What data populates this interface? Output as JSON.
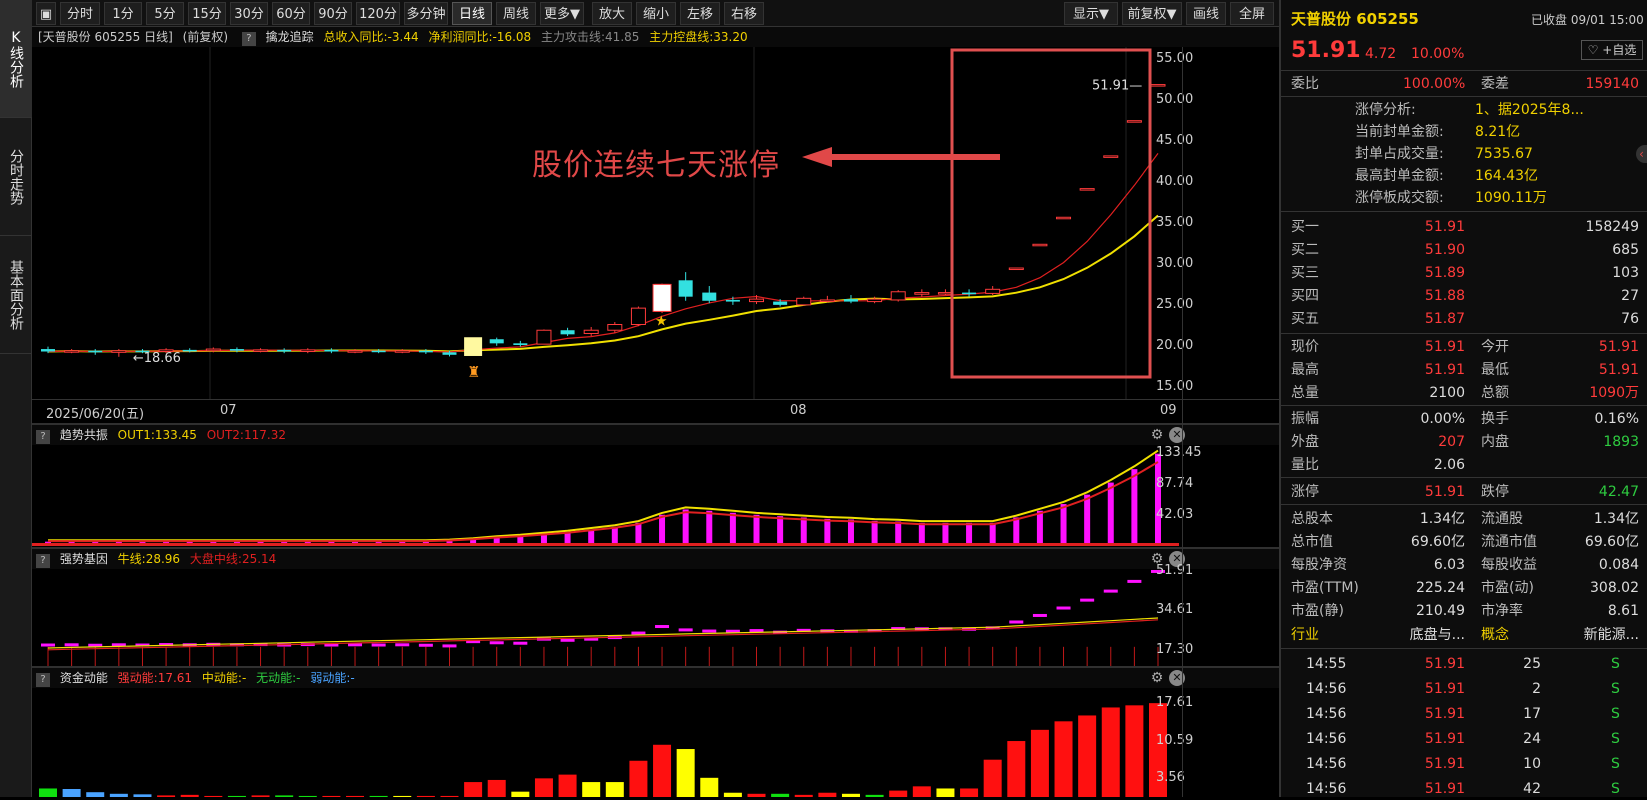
{
  "nav": {
    "tabs": [
      {
        "label": "K线分析",
        "active": true
      },
      {
        "label": "分时走势",
        "active": false
      },
      {
        "label": "基本面分析",
        "active": false
      }
    ]
  },
  "toolbar": {
    "buttons": [
      "分时",
      "1分",
      "5分",
      "15分",
      "30分",
      "60分",
      "90分",
      "120分",
      "多分钟",
      "日线",
      "周线",
      "更多▼",
      "放大",
      "缩小",
      "左移",
      "右移",
      "显示▼",
      "前复权▼",
      "画线",
      "全屏"
    ],
    "active": "日线"
  },
  "main_chart": {
    "info": {
      "title": "[天普股份 605255 日线]",
      "adjust": "(前复权)",
      "indicator": "擒龙追踪",
      "rev_yoy": "总收入同比:-3.44",
      "profit_yoy": "净利润同比:-16.08",
      "attack_line": "主力攻击线:41.85",
      "control_line": "主力控盘线:33.20"
    },
    "annotation": "股价连续七天涨停",
    "low_marker": "18.66",
    "high_marker": "51.91",
    "date_labels": [
      "2025/06/20(五)",
      "07",
      "08",
      "09"
    ],
    "colors": {
      "up": "#ff3b3b",
      "down": "#33e0e0",
      "ma1": "#f0e000",
      "ma2": "#e02020",
      "highlight": "#e05050"
    }
  },
  "chart_data": [
    {
      "type": "candlestick",
      "title": "天普股份 605255 日线",
      "yticks": [
        "55.00",
        "50.00",
        "45.00",
        "40.00",
        "35.00",
        "30.00",
        "25.00",
        "20.00",
        "15.00"
      ],
      "ylim": [
        13.5,
        56.5
      ],
      "x_labels": [
        "2025/06/20(五)",
        "07",
        "08",
        "09"
      ],
      "candles": [
        {
          "o": 19.6,
          "c": 19.3,
          "h": 19.9,
          "l": 19.1
        },
        {
          "o": 19.3,
          "c": 19.4,
          "h": 19.6,
          "l": 19.1
        },
        {
          "o": 19.4,
          "c": 19.2,
          "h": 19.6,
          "l": 18.9
        },
        {
          "o": 19.2,
          "c": 19.4,
          "h": 19.6,
          "l": 18.66
        },
        {
          "o": 19.4,
          "c": 19.3,
          "h": 19.6,
          "l": 19.1
        },
        {
          "o": 19.3,
          "c": 19.5,
          "h": 19.7,
          "l": 19.1
        },
        {
          "o": 19.5,
          "c": 19.4,
          "h": 19.7,
          "l": 19.2
        },
        {
          "o": 19.4,
          "c": 19.6,
          "h": 19.8,
          "l": 19.2
        },
        {
          "o": 19.6,
          "c": 19.4,
          "h": 19.8,
          "l": 19.2
        },
        {
          "o": 19.4,
          "c": 19.5,
          "h": 19.7,
          "l": 19.2
        },
        {
          "o": 19.5,
          "c": 19.3,
          "h": 19.7,
          "l": 19.1
        },
        {
          "o": 19.3,
          "c": 19.5,
          "h": 19.7,
          "l": 19.1
        },
        {
          "o": 19.5,
          "c": 19.3,
          "h": 19.7,
          "l": 19.1
        },
        {
          "o": 19.3,
          "c": 19.4,
          "h": 19.6,
          "l": 19.1
        },
        {
          "o": 19.4,
          "c": 19.3,
          "h": 19.6,
          "l": 19.1
        },
        {
          "o": 19.3,
          "c": 19.4,
          "h": 19.6,
          "l": 19.1
        },
        {
          "o": 19.4,
          "c": 19.2,
          "h": 19.6,
          "l": 19.0
        },
        {
          "o": 19.2,
          "c": 18.9,
          "h": 19.4,
          "l": 18.7
        },
        {
          "o": 19.0,
          "c": 20.8,
          "h": 20.8,
          "l": 19.0
        },
        {
          "o": 20.8,
          "c": 20.3,
          "h": 21.0,
          "l": 20.0
        },
        {
          "o": 20.3,
          "c": 20.1,
          "h": 20.6,
          "l": 19.9
        },
        {
          "o": 20.2,
          "c": 21.9,
          "h": 22.0,
          "l": 20.2
        },
        {
          "o": 21.9,
          "c": 21.4,
          "h": 22.2,
          "l": 21.2
        },
        {
          "o": 21.5,
          "c": 21.9,
          "h": 22.3,
          "l": 21.2
        },
        {
          "o": 21.9,
          "c": 22.6,
          "h": 22.9,
          "l": 21.6
        },
        {
          "o": 22.6,
          "c": 24.6,
          "h": 24.8,
          "l": 22.4
        },
        {
          "o": 24.2,
          "c": 27.5,
          "h": 27.6,
          "l": 24.0
        },
        {
          "o": 28.0,
          "c": 26.0,
          "h": 29.0,
          "l": 25.5
        },
        {
          "o": 26.5,
          "c": 25.5,
          "h": 27.3,
          "l": 25.2
        },
        {
          "o": 25.6,
          "c": 25.4,
          "h": 26.0,
          "l": 25.0
        },
        {
          "o": 25.4,
          "c": 25.7,
          "h": 26.2,
          "l": 25.1
        },
        {
          "o": 25.4,
          "c": 25.0,
          "h": 25.7,
          "l": 24.8
        },
        {
          "o": 25.0,
          "c": 25.8,
          "h": 26.0,
          "l": 24.9
        },
        {
          "o": 25.6,
          "c": 25.6,
          "h": 26.1,
          "l": 25.3
        },
        {
          "o": 25.7,
          "c": 25.4,
          "h": 26.2,
          "l": 25.2
        },
        {
          "o": 25.4,
          "c": 25.7,
          "h": 26.0,
          "l": 25.2
        },
        {
          "o": 25.6,
          "c": 26.6,
          "h": 26.8,
          "l": 25.4
        },
        {
          "o": 26.3,
          "c": 26.5,
          "h": 26.9,
          "l": 26.0
        },
        {
          "o": 26.5,
          "c": 26.5,
          "h": 26.9,
          "l": 26.2
        },
        {
          "o": 26.5,
          "c": 26.3,
          "h": 26.9,
          "l": 26.0
        },
        {
          "o": 26.4,
          "c": 26.9,
          "h": 27.3,
          "l": 26.2
        },
        {
          "o": 29.5,
          "c": 29.5,
          "h": 29.5,
          "l": 29.5
        },
        {
          "o": 32.4,
          "c": 32.4,
          "h": 32.4,
          "l": 32.4
        },
        {
          "o": 35.7,
          "c": 35.7,
          "h": 35.7,
          "l": 35.7
        },
        {
          "o": 39.2,
          "c": 39.2,
          "h": 39.2,
          "l": 39.2
        },
        {
          "o": 43.2,
          "c": 43.2,
          "h": 43.2,
          "l": 43.2
        },
        {
          "o": 47.5,
          "c": 47.5,
          "h": 47.5,
          "l": 47.5
        },
        {
          "o": 51.91,
          "c": 51.91,
          "h": 51.91,
          "l": 51.91
        }
      ]
    },
    {
      "type": "bar",
      "title": "趋势共振",
      "series": [
        {
          "name": "OUT1",
          "value_label": "OUT1:133.45"
        },
        {
          "name": "OUT2",
          "value_label": "OUT2:117.32"
        }
      ],
      "yticks": [
        "133.45",
        "87.74",
        "42.03"
      ],
      "ylim": [
        0,
        140
      ],
      "values": [
        2,
        2,
        2,
        2,
        2,
        2,
        2,
        2,
        2,
        2,
        2,
        2,
        2,
        2,
        2,
        2,
        2,
        3,
        5,
        8,
        10,
        13,
        16,
        20,
        24,
        30,
        42,
        50,
        48,
        45,
        42,
        40,
        38,
        36,
        35,
        33,
        32,
        30,
        30,
        30,
        30,
        38,
        48,
        58,
        72,
        90,
        110,
        133
      ]
    },
    {
      "type": "line",
      "title": "强势基因",
      "series": [
        {
          "name": "牛线",
          "value_label": "牛线:28.96"
        },
        {
          "name": "大盘中线",
          "value_label": "大盘中线:25.14"
        }
      ],
      "yticks": [
        "51.91",
        "34.61",
        "17.30"
      ]
    },
    {
      "type": "bar",
      "title": "资金动能",
      "series": [
        {
          "name": "强动能",
          "value_label": "强动能:17.61"
        },
        {
          "name": "中动能",
          "value_label": "中动能:-"
        },
        {
          "name": "无动能",
          "value_label": "无动能:-"
        },
        {
          "name": "弱动能",
          "value_label": "弱动能:-"
        }
      ],
      "yticks": [
        "17.61",
        "10.59",
        "3.56"
      ],
      "ylim": [
        0,
        18.2
      ]
    }
  ],
  "panel2": {
    "name": "趋势共振",
    "out1": "OUT1:133.45",
    "out2": "OUT2:117.32"
  },
  "panel3": {
    "name": "强势基因",
    "bull": "牛线:28.96",
    "mid": "大盘中线:25.14"
  },
  "panel4": {
    "name": "资金动能",
    "strong": "强动能:17.61",
    "middle": "中动能:-",
    "none": "无动能:-",
    "weak": "弱动能:-"
  },
  "right": {
    "name": "天普股份 605255",
    "status": "已收盘 09/01 15:00",
    "price": "51.91",
    "change": "4.72",
    "pct": "10.00%",
    "fav": "+自选",
    "weibi_label": "委比",
    "weibi": "100.00%",
    "weicha_label": "委差",
    "weicha": "159140",
    "limit_info": [
      {
        "label": "涨停分析:",
        "value": "1、据2025年8..."
      },
      {
        "label": "当前封单金额:",
        "value": "8.21亿"
      },
      {
        "label": "封单占成交量:",
        "value": "7535.67"
      },
      {
        "label": "最高封单金额:",
        "value": "164.43亿"
      },
      {
        "label": "涨停板成交额:",
        "value": "1090.11万"
      }
    ],
    "bids": [
      {
        "label": "买一",
        "price": "51.91",
        "vol": "158249"
      },
      {
        "label": "买二",
        "price": "51.90",
        "vol": "685"
      },
      {
        "label": "买三",
        "price": "51.89",
        "vol": "103"
      },
      {
        "label": "买四",
        "price": "51.88",
        "vol": "27"
      },
      {
        "label": "买五",
        "price": "51.87",
        "vol": "76"
      }
    ],
    "quote": [
      {
        "l1": "现价",
        "v1": "51.91",
        "l2": "今开",
        "v2": "51.91"
      },
      {
        "l1": "最高",
        "v1": "51.91",
        "l2": "最低",
        "v2": "51.91"
      },
      {
        "l1": "总量",
        "v1": "2100",
        "l2": "总额",
        "v2": "1090万"
      }
    ],
    "quote2": [
      {
        "l1": "振幅",
        "v1": "0.00%",
        "l2": "换手",
        "v2": "0.16%"
      },
      {
        "l1": "外盘",
        "v1": "207",
        "l2": "内盘",
        "v2": "1893"
      },
      {
        "l1": "量比",
        "v1": "2.06",
        "l2": "",
        "v2": ""
      }
    ],
    "limits": {
      "up_label": "涨停",
      "up": "51.91",
      "down_label": "跌停",
      "down": "42.47"
    },
    "fund": [
      {
        "l1": "总股本",
        "v1": "1.34亿",
        "l2": "流通股",
        "v2": "1.34亿"
      },
      {
        "l1": "总市值",
        "v1": "69.60亿",
        "l2": "流通市值",
        "v2": "69.60亿"
      },
      {
        "l1": "每股净资",
        "v1": "6.03",
        "l2": "每股收益",
        "v2": "0.084"
      },
      {
        "l1": "市盈(TTM)",
        "v1": "225.24",
        "l2": "市盈(动)",
        "v2": "308.02"
      },
      {
        "l1": "市盈(静)",
        "v1": "210.49",
        "l2": "市净率",
        "v2": "8.61"
      }
    ],
    "industry": {
      "l1": "行业",
      "v1": "底盘与...",
      "l2": "概念",
      "v2": "新能源..."
    },
    "ticks": [
      {
        "time": "14:55",
        "price": "51.91",
        "vol": "25",
        "side": "S"
      },
      {
        "time": "14:56",
        "price": "51.91",
        "vol": "2",
        "side": "S"
      },
      {
        "time": "14:56",
        "price": "51.91",
        "vol": "17",
        "side": "S"
      },
      {
        "time": "14:56",
        "price": "51.91",
        "vol": "24",
        "side": "S"
      },
      {
        "time": "14:56",
        "price": "51.91",
        "vol": "10",
        "side": "S"
      },
      {
        "time": "14:56",
        "price": "51.91",
        "vol": "42",
        "side": "S"
      }
    ]
  }
}
